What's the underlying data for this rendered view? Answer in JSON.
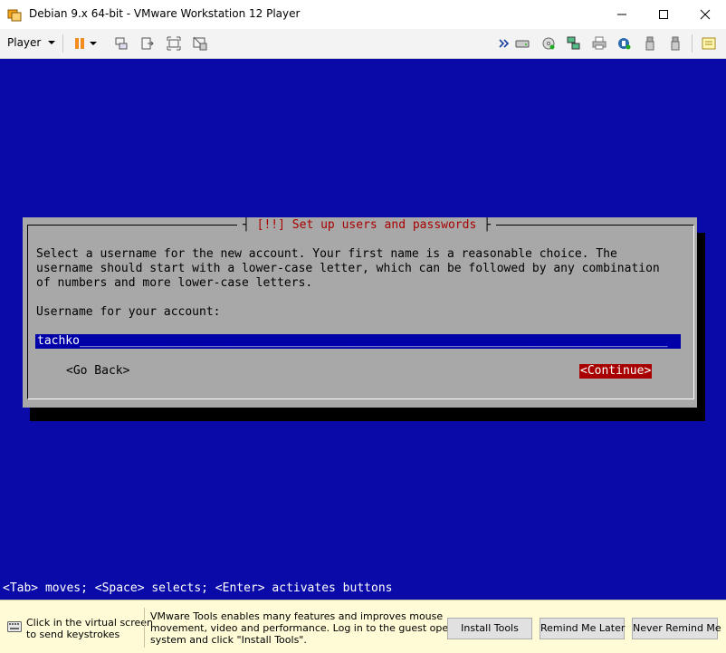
{
  "window": {
    "title": "Debian 9.x 64-bit - VMware Workstation 12 Player",
    "controls": {
      "minimize": "—",
      "maximize": "☐",
      "close": "✕"
    }
  },
  "toolbar": {
    "player_menu": "Player",
    "icons": [
      "pause-icon",
      "send-ctrl-alt-del-icon",
      "fit-guest-icon",
      "full-screen-icon",
      "unity-icon",
      "more-devices-icon",
      "hard-disk-icon",
      "cd-dvd-icon",
      "network-adapter-icon",
      "printer-icon",
      "sound-card-icon",
      "usb-device-icon",
      "usb-device-2-icon",
      "message-log-icon"
    ]
  },
  "console": {
    "dialog": {
      "title_prefix": "[!!]",
      "title": "Set up users and passwords",
      "body_lines": [
        "Select a username for the new account. Your first name is a reasonable choice. The",
        "username should start with a lower-case letter, which can be followed by any combination",
        "of numbers and more lower-case letters."
      ],
      "field_label": "Username for your account:",
      "field_value": "tachko",
      "go_back": "<Go Back>",
      "continue": "<Continue>"
    },
    "status_line": "<Tab> moves; <Space> selects; <Enter> activates buttons"
  },
  "notification": {
    "left_lines": [
      "Click in the virtual screen",
      "to send keystrokes"
    ],
    "message_lines": [
      "VMware Tools enables many features and improves mouse",
      "movement, video and performance. Log in to the guest operating",
      "system and click \"Install Tools\"."
    ],
    "buttons": {
      "install": "Install Tools",
      "remind_later": "Remind Me Later",
      "never_remind": "Never Remind Me"
    }
  },
  "colors": {
    "console_bg": "#0a0aa8",
    "dialog_bg": "#a8a8a8",
    "accent_red": "#a80000",
    "notify_bg": "#fffbd6"
  }
}
